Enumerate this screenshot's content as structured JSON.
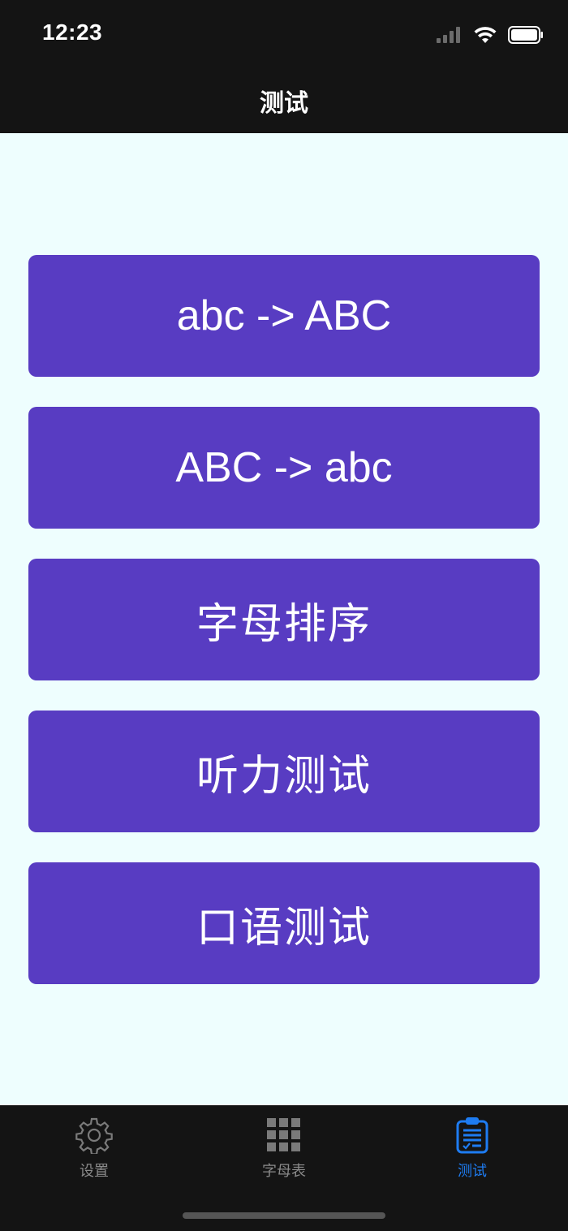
{
  "status_bar": {
    "time": "12:23"
  },
  "header": {
    "title": "测试"
  },
  "menu": {
    "items": [
      {
        "label": "abc -> ABC"
      },
      {
        "label": "ABC -> abc"
      },
      {
        "label": "字母排序"
      },
      {
        "label": "听力测试"
      },
      {
        "label": "口语测试"
      }
    ]
  },
  "tabbar": {
    "items": [
      {
        "label": "设置",
        "icon": "gear-icon"
      },
      {
        "label": "字母表",
        "icon": "grid-icon"
      },
      {
        "label": "测试",
        "icon": "clipboard-icon",
        "active": true
      }
    ]
  },
  "colors": {
    "background": "#eefefe",
    "bar": "#141414",
    "button": "#583cc2",
    "active_tab": "#1e7cf2",
    "inactive_tab": "#8a8a8a"
  }
}
